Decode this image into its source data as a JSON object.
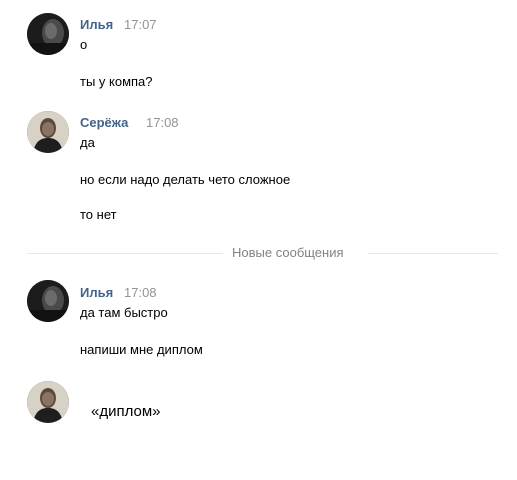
{
  "groups": [
    {
      "author": "Илья",
      "time": "17:07",
      "messages": [
        "о",
        "ты у компа?"
      ]
    },
    {
      "author": "Серёжа",
      "time": "17:08",
      "messages": [
        "да",
        "но если надо делать чето сложное",
        "то нет"
      ]
    },
    {
      "author": "Илья",
      "time": "17:08",
      "messages": [
        "да там быстро",
        "напиши мне диплом"
      ]
    }
  ],
  "divider": {
    "label": "Новые сообщения"
  },
  "reply": {
    "text": "«диплом»"
  },
  "icons": {
    "avatar_ilya": "user-photo-icon",
    "avatar_serezha": "user-photo-icon"
  },
  "colors": {
    "author_name": "#42648b",
    "timestamp": "#939393",
    "divider_text": "#828282",
    "divider_line": "#e7e8ec"
  }
}
